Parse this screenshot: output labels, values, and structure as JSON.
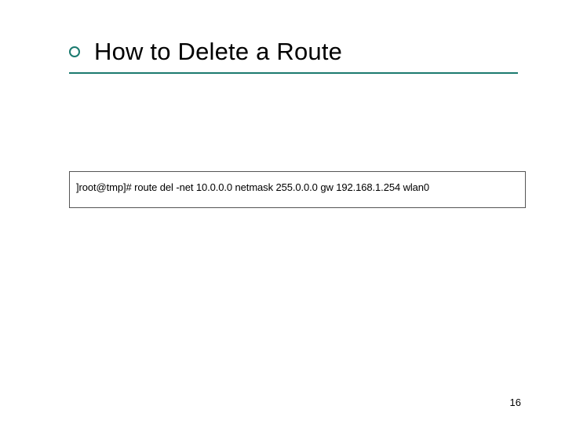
{
  "slide": {
    "title": "How to Delete a Route",
    "command": "]root@tmp]# route del -net 10.0.0.0 netmask 255.0.0.0 gw 192.168.1.254 wlan0",
    "page_number": "16"
  }
}
